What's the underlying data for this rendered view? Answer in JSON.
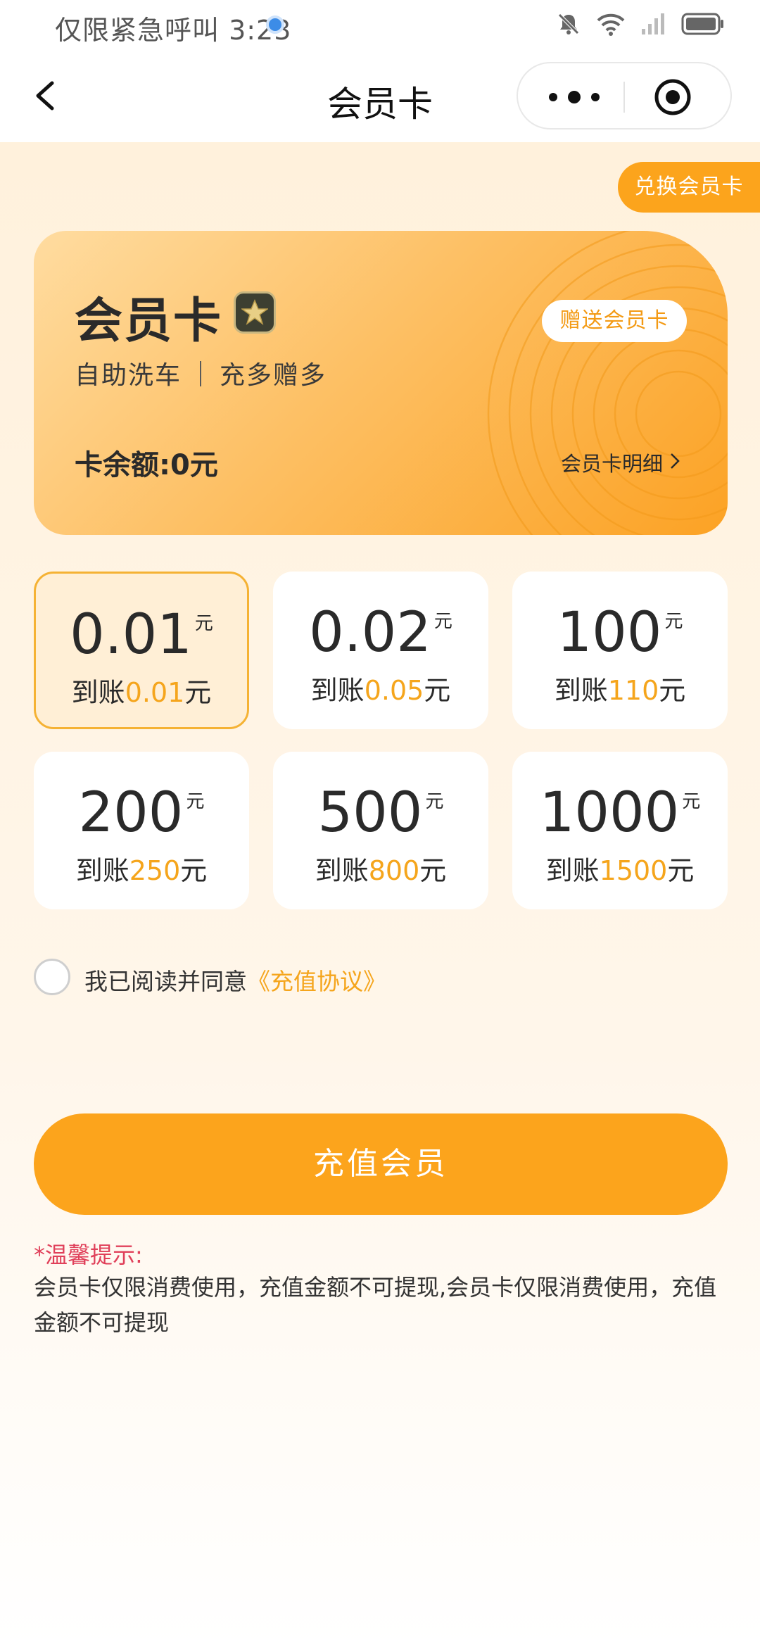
{
  "status_bar": {
    "text": "仅限紧急呼叫 3:23",
    "icons": [
      "mute-bell-icon",
      "wifi-icon",
      "signal-icon",
      "battery-icon"
    ]
  },
  "nav": {
    "title": "会员卡",
    "icons": [
      "back-chevron-icon",
      "more-dots-icon",
      "target-icon"
    ]
  },
  "exchange_button": "兑换会员卡",
  "card": {
    "title": "会员卡",
    "subtitle_left": "自助洗车",
    "subtitle_right": "充多赠多",
    "gift_button": "赠送会员卡",
    "balance": "卡余额:0元",
    "detail_link": "会员卡明细",
    "badge_icon": "star-badge-icon"
  },
  "amounts": [
    {
      "value": "0.01",
      "unit": "元",
      "prefix": "到账",
      "credit": "0.01",
      "suffix": "元",
      "selected": true
    },
    {
      "value": "0.02",
      "unit": "元",
      "prefix": "到账",
      "credit": "0.05",
      "suffix": "元",
      "selected": false
    },
    {
      "value": "100",
      "unit": "元",
      "prefix": "到账",
      "credit": "110",
      "suffix": "元",
      "selected": false
    },
    {
      "value": "200",
      "unit": "元",
      "prefix": "到账",
      "credit": "250",
      "suffix": "元",
      "selected": false
    },
    {
      "value": "500",
      "unit": "元",
      "prefix": "到账",
      "credit": "800",
      "suffix": "元",
      "selected": false
    },
    {
      "value": "1000",
      "unit": "元",
      "prefix": "到账",
      "credit": "1500",
      "suffix": "元",
      "selected": false
    }
  ],
  "agreement": {
    "text": "我已阅读并同意",
    "link": "《充值协议》",
    "checked": false
  },
  "recharge_button": "充值会员",
  "tips": {
    "title": "*温馨提示:",
    "body": "会员卡仅限消费使用，充值金额不可提现,会员卡仅限消费使用，充值金额不可提现"
  },
  "colors": {
    "accent": "#fca41c",
    "highlight": "#f5a51c",
    "tip_red": "#e0405a"
  }
}
